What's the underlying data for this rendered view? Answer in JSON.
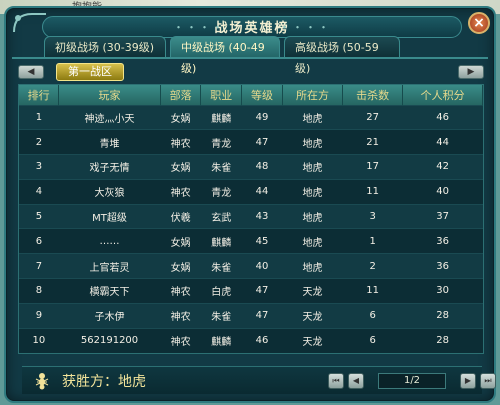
{
  "header": {
    "cut_text": "抱抱能",
    "title": "战场英雄榜",
    "close_label": "×"
  },
  "tabs": [
    {
      "label": "初级战场 (30-39级)",
      "active": false
    },
    {
      "label": "中级战场 (40-49级)",
      "active": true
    },
    {
      "label": "高级战场 (50-59级)",
      "active": false
    }
  ],
  "zone": {
    "label": "第一战区"
  },
  "icons": {
    "prev_zone": "arrow-left-icon",
    "next_zone": "arrow-right-icon",
    "winner": "ant-icon"
  },
  "table": {
    "columns": [
      "排行",
      "玩家",
      "部落",
      "职业",
      "等级",
      "所在方",
      "击杀数",
      "个人积分"
    ],
    "rows": [
      [
        "1",
        "神迹灬小天",
        "女娲",
        "麒麟",
        "49",
        "地虎",
        "27",
        "46"
      ],
      [
        "2",
        "青堆",
        "神农",
        "青龙",
        "47",
        "地虎",
        "21",
        "44"
      ],
      [
        "3",
        "戏子无情",
        "女娲",
        "朱雀",
        "48",
        "地虎",
        "17",
        "42"
      ],
      [
        "4",
        "大灰狼",
        "神农",
        "青龙",
        "44",
        "地虎",
        "11",
        "40"
      ],
      [
        "5",
        "MT超级",
        "伏羲",
        "玄武",
        "43",
        "地虎",
        "3",
        "37"
      ],
      [
        "6",
        "……",
        "女娲",
        "麒麟",
        "45",
        "地虎",
        "1",
        "36"
      ],
      [
        "7",
        "上官若灵",
        "女娲",
        "朱雀",
        "40",
        "地虎",
        "2",
        "36"
      ],
      [
        "8",
        "横霸天下",
        "神农",
        "白虎",
        "47",
        "天龙",
        "11",
        "30"
      ],
      [
        "9",
        "子木伊",
        "神农",
        "朱雀",
        "47",
        "天龙",
        "6",
        "28"
      ],
      [
        "10",
        "562191200",
        "神农",
        "麒麟",
        "46",
        "天龙",
        "6",
        "28"
      ]
    ]
  },
  "footer": {
    "winner_text": "获胜方：地虎",
    "page_text": "1/2"
  },
  "colors": {
    "frame": "#123a45",
    "header_row": "#3a8c88",
    "zone_tab": "#b8a32c",
    "accent_text": "#e5d98c"
  }
}
